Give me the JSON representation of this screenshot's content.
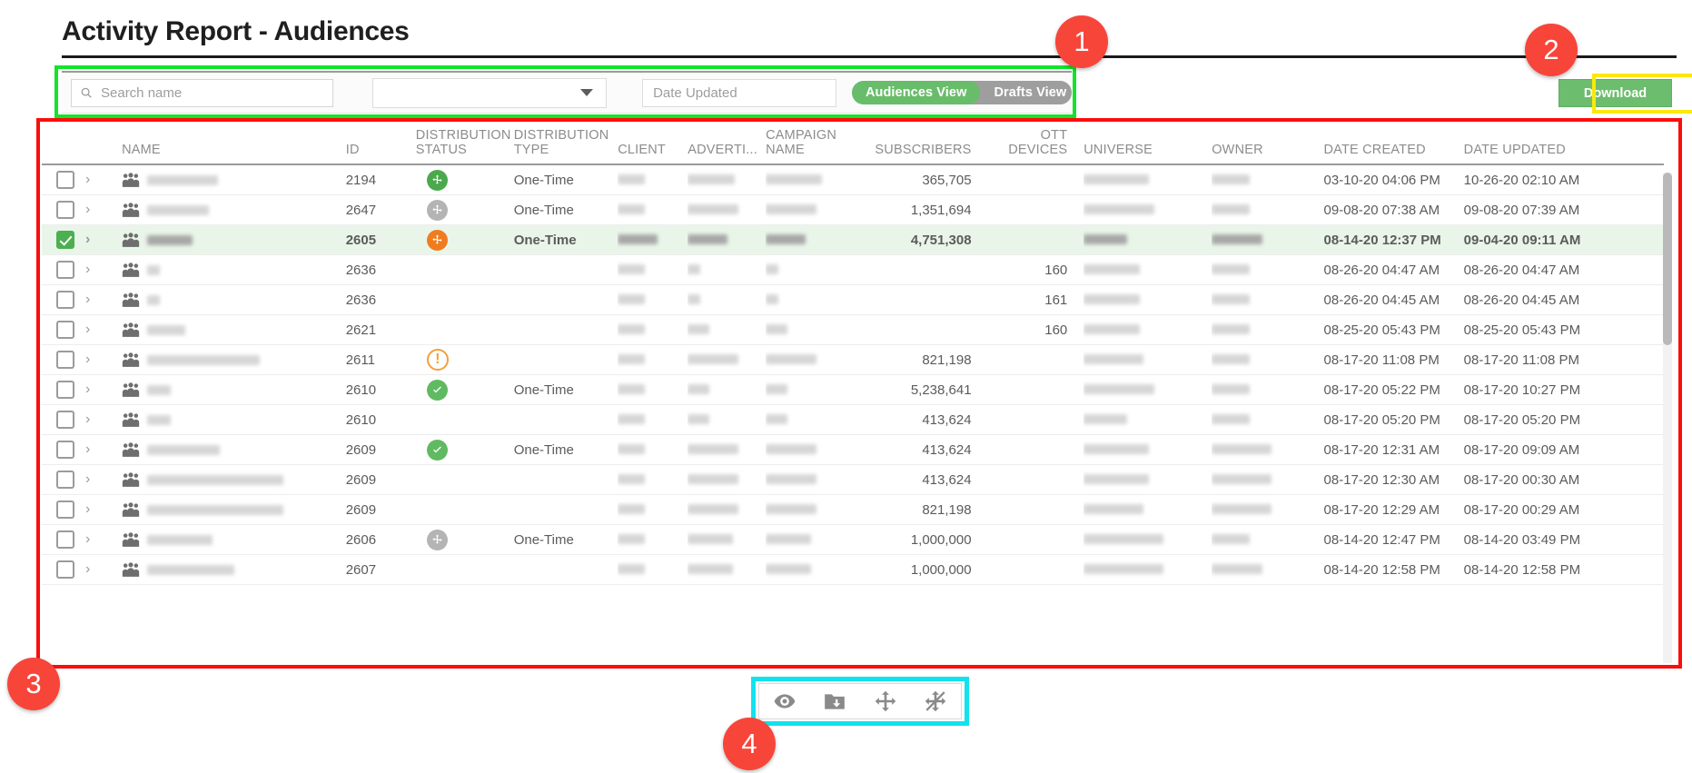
{
  "page": {
    "title": "Activity Report - Audiences"
  },
  "toolbar": {
    "search": {
      "name": "search-input",
      "value": "",
      "placeholder": "Search name"
    },
    "filter_select": {
      "value": "",
      "placeholder": ""
    },
    "date_filter": {
      "value": "",
      "placeholder": "Date Updated"
    },
    "view_toggle": {
      "active": "Audiences View",
      "options": [
        "Audiences View",
        "Drafts View"
      ]
    }
  },
  "download_button": {
    "label": "Download"
  },
  "table": {
    "columns": [
      {
        "key": "check",
        "label": ""
      },
      {
        "key": "name",
        "label": "NAME"
      },
      {
        "key": "id",
        "label": "ID"
      },
      {
        "key": "dist_status",
        "label": "DISTRIBUTION STATUS"
      },
      {
        "key": "dist_type",
        "label": "DISTRIBUTION TYPE"
      },
      {
        "key": "client",
        "label": "CLIENT"
      },
      {
        "key": "advertiser",
        "label": "ADVERTI..."
      },
      {
        "key": "campaign",
        "label": "CAMPAIGN NAME"
      },
      {
        "key": "subscribers",
        "label": "SUBSCRIBERS"
      },
      {
        "key": "ott_devices",
        "label": "OTT DEVICES"
      },
      {
        "key": "universe",
        "label": "UNIVERSE"
      },
      {
        "key": "owner",
        "label": "OWNER"
      },
      {
        "key": "date_created",
        "label": "DATE CREATED"
      },
      {
        "key": "date_updated",
        "label": "DATE UPDATED"
      }
    ],
    "rows": [
      {
        "selected": false,
        "name_w": 78,
        "id": "2194",
        "status": "distribute-green",
        "type": "One-Time",
        "client_w": 30,
        "adv_w": 52,
        "camp_w": 62,
        "subscribers": "365,705",
        "ott": "",
        "universe_w": 72,
        "owner_w": 42,
        "created": "03-10-20 04:06 PM",
        "updated": "10-26-20 02:10 AM"
      },
      {
        "selected": false,
        "name_w": 68,
        "id": "2647",
        "status": "distribute-grey",
        "type": "One-Time",
        "client_w": 30,
        "adv_w": 56,
        "camp_w": 56,
        "subscribers": "1,351,694",
        "ott": "",
        "universe_w": 78,
        "owner_w": 42,
        "created": "09-08-20 07:38 AM",
        "updated": "09-08-20 07:39 AM"
      },
      {
        "selected": true,
        "name_w": 50,
        "id": "2605",
        "status": "distribute-orange",
        "type": "One-Time",
        "client_w": 44,
        "adv_w": 44,
        "camp_w": 44,
        "subscribers": "4,751,308",
        "ott": "",
        "universe_w": 48,
        "owner_w": 56,
        "created": "08-14-20 12:37 PM",
        "updated": "09-04-20 09:11 AM"
      },
      {
        "selected": false,
        "name_w": 14,
        "id": "2636",
        "status": "",
        "type": "",
        "client_w": 30,
        "adv_w": 14,
        "camp_w": 14,
        "subscribers": "",
        "ott": "160",
        "universe_w": 62,
        "owner_w": 42,
        "created": "08-26-20 04:47 AM",
        "updated": "08-26-20 04:47 AM"
      },
      {
        "selected": false,
        "name_w": 14,
        "id": "2636",
        "status": "",
        "type": "",
        "client_w": 30,
        "adv_w": 14,
        "camp_w": 14,
        "subscribers": "",
        "ott": "161",
        "universe_w": 62,
        "owner_w": 42,
        "created": "08-26-20 04:45 AM",
        "updated": "08-26-20 04:45 AM"
      },
      {
        "selected": false,
        "name_w": 42,
        "id": "2621",
        "status": "",
        "type": "",
        "client_w": 30,
        "adv_w": 24,
        "camp_w": 24,
        "subscribers": "",
        "ott": "160",
        "universe_w": 62,
        "owner_w": 42,
        "created": "08-25-20 05:43 PM",
        "updated": "08-25-20 05:43 PM"
      },
      {
        "selected": false,
        "name_w": 124,
        "id": "2611",
        "status": "warning",
        "type": "",
        "client_w": 30,
        "adv_w": 56,
        "camp_w": 56,
        "subscribers": "821,198",
        "ott": "",
        "universe_w": 66,
        "owner_w": 42,
        "created": "08-17-20 11:08 PM",
        "updated": "08-17-20 11:08 PM"
      },
      {
        "selected": false,
        "name_w": 26,
        "id": "2610",
        "status": "check",
        "type": "One-Time",
        "client_w": 30,
        "adv_w": 24,
        "camp_w": 24,
        "subscribers": "5,238,641",
        "ott": "",
        "universe_w": 78,
        "owner_w": 42,
        "created": "08-17-20 05:22 PM",
        "updated": "08-17-20 10:27 PM"
      },
      {
        "selected": false,
        "name_w": 26,
        "id": "2610",
        "status": "",
        "type": "",
        "client_w": 30,
        "adv_w": 24,
        "camp_w": 24,
        "subscribers": "413,624",
        "ott": "",
        "universe_w": 48,
        "owner_w": 42,
        "created": "08-17-20 05:20 PM",
        "updated": "08-17-20 05:20 PM"
      },
      {
        "selected": false,
        "name_w": 80,
        "id": "2609",
        "status": "check",
        "type": "One-Time",
        "client_w": 30,
        "adv_w": 56,
        "camp_w": 56,
        "subscribers": "413,624",
        "ott": "",
        "universe_w": 72,
        "owner_w": 66,
        "created": "08-17-20 12:31 AM",
        "updated": "08-17-20 09:09 AM"
      },
      {
        "selected": false,
        "name_w": 150,
        "id": "2609",
        "status": "",
        "type": "",
        "client_w": 30,
        "adv_w": 56,
        "camp_w": 56,
        "subscribers": "413,624",
        "ott": "",
        "universe_w": 72,
        "owner_w": 66,
        "created": "08-17-20 12:30 AM",
        "updated": "08-17-20 00:30 AM"
      },
      {
        "selected": false,
        "name_w": 150,
        "id": "2609",
        "status": "",
        "type": "",
        "client_w": 30,
        "adv_w": 56,
        "camp_w": 56,
        "subscribers": "821,198",
        "ott": "",
        "universe_w": 66,
        "owner_w": 66,
        "created": "08-17-20 12:29 AM",
        "updated": "08-17-20 00:29 AM"
      },
      {
        "selected": false,
        "name_w": 72,
        "id": "2606",
        "status": "distribute-grey",
        "type": "One-Time",
        "client_w": 30,
        "adv_w": 50,
        "camp_w": 50,
        "subscribers": "1,000,000",
        "ott": "",
        "universe_w": 88,
        "owner_w": 42,
        "created": "08-14-20 12:47 PM",
        "updated": "08-14-20 03:49 PM"
      },
      {
        "selected": false,
        "name_w": 96,
        "id": "2607",
        "status": "",
        "type": "",
        "client_w": 30,
        "adv_w": 50,
        "camp_w": 50,
        "subscribers": "1,000,000",
        "ott": "",
        "universe_w": 88,
        "owner_w": 56,
        "created": "08-14-20 12:58 PM",
        "updated": "08-14-20 12:58 PM"
      }
    ]
  },
  "action_bar": {
    "buttons": [
      {
        "name": "view-icon",
        "label": "View"
      },
      {
        "name": "archive-folder-icon",
        "label": "Archive"
      },
      {
        "name": "distribute-icon",
        "label": "Distribute"
      },
      {
        "name": "stop-distribute-icon",
        "label": "Stop Distribution"
      }
    ]
  },
  "annotations": {
    "badges": [
      {
        "number": "1"
      },
      {
        "number": "2"
      },
      {
        "number": "3"
      },
      {
        "number": "4"
      }
    ],
    "colors": {
      "green": "#12e42b",
      "red": "#fb0d0d",
      "yellow": "#fbe80c",
      "cyan": "#11e2ee",
      "badge": "#f7453a"
    }
  }
}
